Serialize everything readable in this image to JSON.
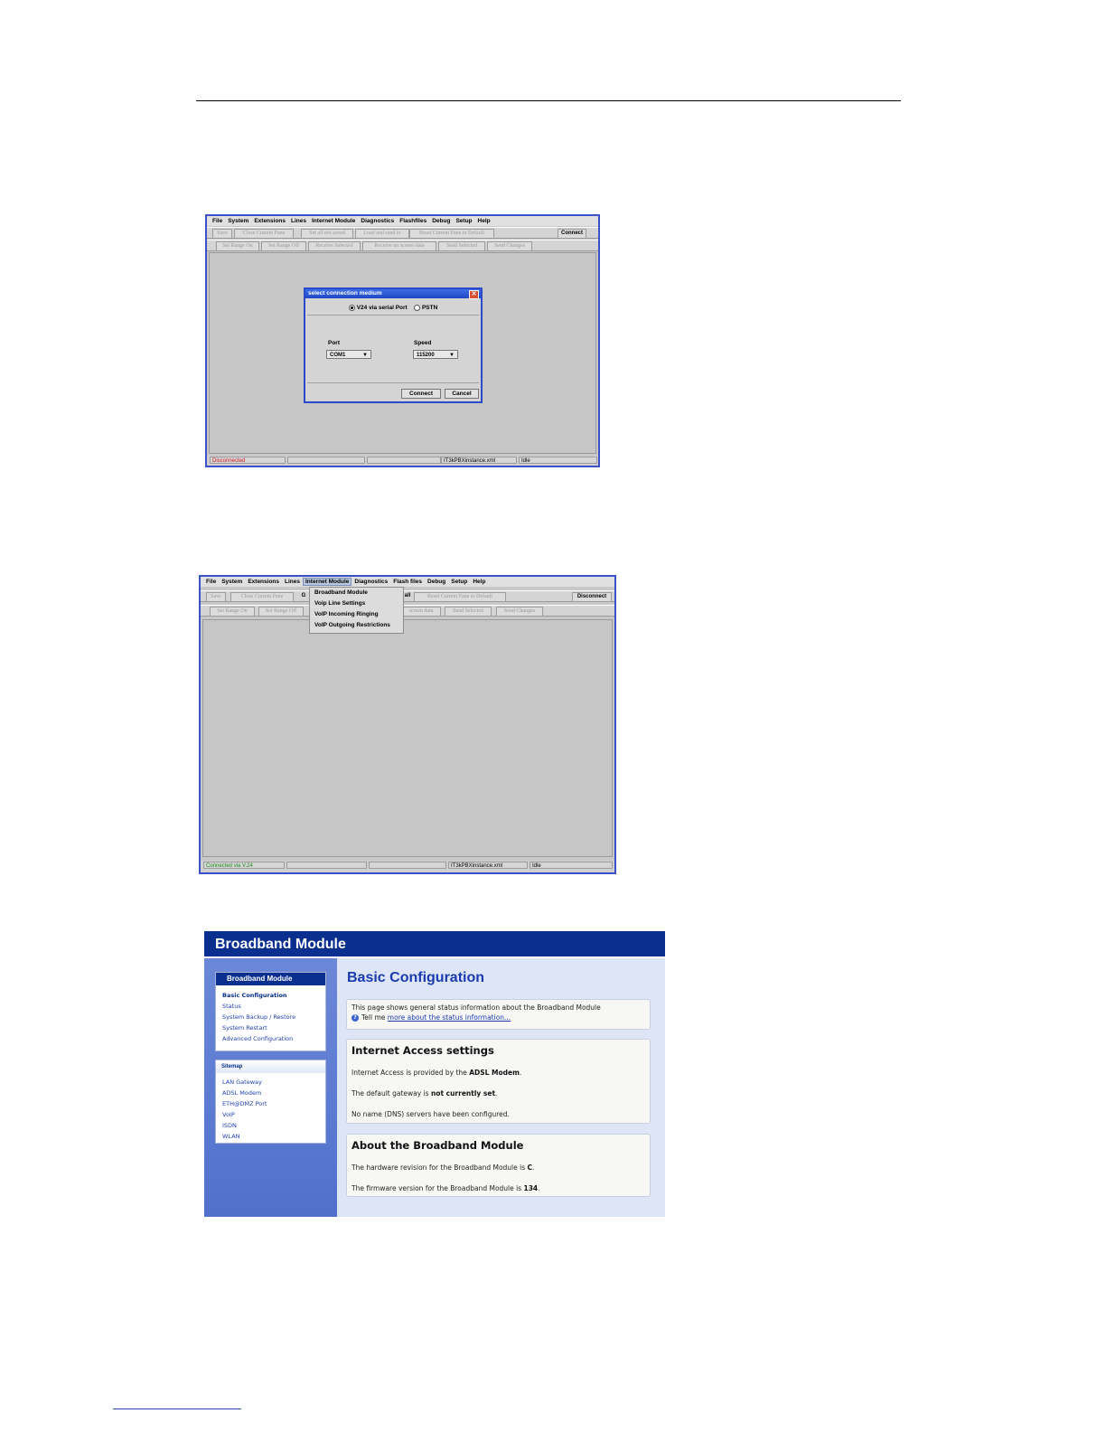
{
  "screenshot1": {
    "menus": [
      "File",
      "System",
      "Extensions",
      "Lines",
      "Internet Module",
      "Diagnostics",
      "Flashfiles",
      "Debug",
      "Setup",
      "Help"
    ],
    "toolbar1": [
      "Save",
      "Close Current Pane",
      "Set all not saved",
      "Load and send to",
      "Reset Current Pane to Default"
    ],
    "connect_label": "Connect",
    "toolbar2": [
      "Set Range On",
      "Set Range Off",
      "Receive Selected",
      "Receive no screen data",
      "Send Selected",
      "Send Changes"
    ],
    "dialog": {
      "title": "select connection medium",
      "close_glyph": "✕",
      "radio_v24": "V24 via serial Port",
      "radio_pstn": "PSTN",
      "port_label": "Port",
      "port_value": "COM1",
      "speed_label": "Speed",
      "speed_value": "115200",
      "connect": "Connect",
      "cancel": "Cancel"
    },
    "status": {
      "connection": "Disconnected",
      "connection_color": "#d01818",
      "file": "IT3kPBXinstance.xml",
      "state": "Idle"
    }
  },
  "screenshot2": {
    "menus": [
      "File",
      "System",
      "Extensions",
      "Lines",
      "Internet Module",
      "Diagnostics",
      "Flash files",
      "Debug",
      "Setup",
      "Help"
    ],
    "toolbar1": [
      "Save",
      "Close Current Pane",
      "G",
      "all",
      "Reset Current Pane to Default"
    ],
    "disconnect_label": "Disconnect",
    "toolbar2": [
      "Set Range On",
      "Set Range Off",
      "screen data",
      "Send Selected",
      "Send Changes"
    ],
    "dropdown": [
      "Broadband Module",
      "Voip Line Settings",
      "VoIP Incoming Ringing",
      "VoIP Outgoing Restrictions"
    ],
    "status": {
      "connection": "Connected via V.24",
      "connection_color": "#1a8a1a",
      "file": "IT3kPBXinstance.xml",
      "state": "Idle"
    }
  },
  "screenshot3": {
    "header": "Broadband Module",
    "nav": {
      "heading": "Broadband Module",
      "items": [
        "Basic Configuration",
        "Status",
        "System Backup / Restore",
        "System Restart",
        "Advanced Configuration"
      ]
    },
    "sitemap": {
      "heading": "Sitemap",
      "items": [
        "LAN Gateway",
        "ADSL Modem",
        "ETH@DMZ Port",
        "VoIP",
        "ISDN",
        "WLAN"
      ]
    },
    "title": "Basic Configuration",
    "intro": {
      "text": "This page shows general status information about the Broadband Module",
      "tell_me": "Tell me",
      "link": "more about the status information..."
    },
    "internet": {
      "heading": "Internet Access settings",
      "line1_pre": "Internet Access is provided by the ",
      "line1_bold": "ADSL Modem",
      "line1_post": ".",
      "line2_pre": "The default gateway is ",
      "line2_bold": "not currently set",
      "line2_post": ".",
      "line3": "No name (DNS) servers have been configured."
    },
    "about": {
      "heading": "About the Broadband Module",
      "line1_pre": "The hardware revision for the Broadband Module is ",
      "line1_bold": "C",
      "line1_post": ".",
      "line2_pre": "The firmware version for the Broadband Module is ",
      "line2_bold": "134",
      "line2_post": "."
    }
  }
}
